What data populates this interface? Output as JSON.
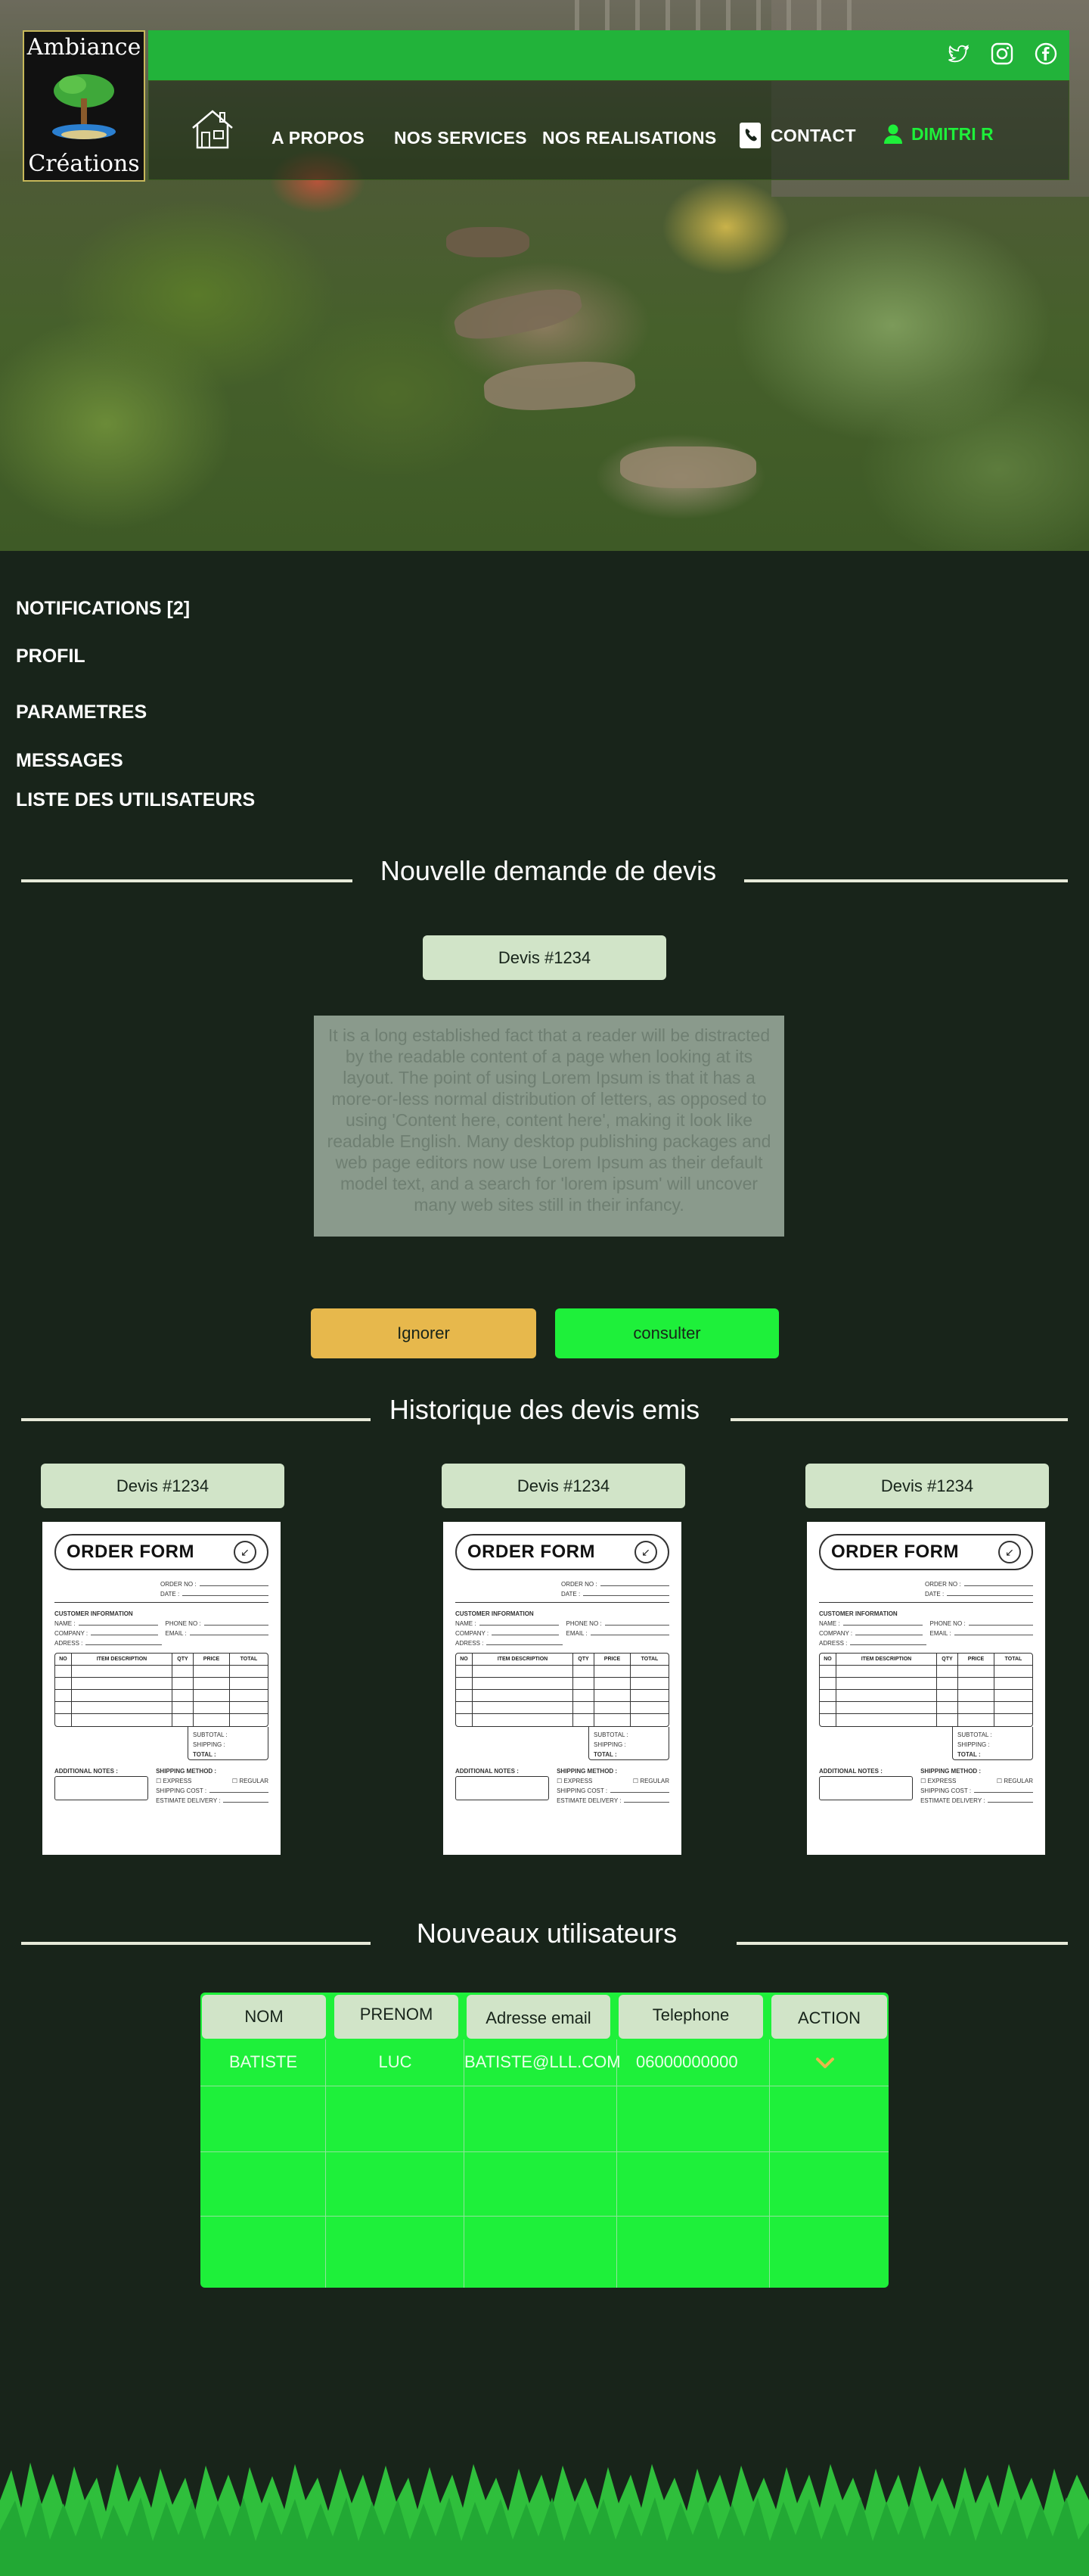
{
  "brand": {
    "line1": "Ambiance",
    "line2": "Créations"
  },
  "nav": {
    "home_icon": "house-icon",
    "items": [
      "A PROPOS",
      "NOS SERVICES",
      "NOS REALISATIONS"
    ],
    "contact_label": "CONTACT",
    "contact_icon": "phone-book-icon",
    "user_label": "DIMITRI R",
    "user_icon": "user-icon",
    "social_icons": [
      "twitter-icon",
      "instagram-icon",
      "facebook-icon"
    ]
  },
  "menu": [
    "NOTIFICATIONS [2]",
    "PROFIL",
    "PARAMETRES",
    "MESSAGES",
    "LISTE DES UTILISATEURS"
  ],
  "request": {
    "title": "Nouvelle demande de devis",
    "devis_label": "Devis #1234",
    "text": "It is a long established fact that a reader will be distracted by the readable content of a page when looking at its layout. The point of using Lorem Ipsum is that it has a more-or-less normal distribution of letters, as opposed to using 'Content here, content here', making it look like readable English. Many desktop publishing packages and web page editors now use Lorem Ipsum as their default model text, and a search for 'lorem ipsum' will uncover many web sites still in their infancy.",
    "ignore_label": "Ignorer",
    "consult_label": "consulter"
  },
  "history": {
    "title": "Historique des devis emis",
    "cards": [
      {
        "label": "Devis #1234"
      },
      {
        "label": "Devis #1234"
      },
      {
        "label": "Devis #1234"
      }
    ]
  },
  "order_form": {
    "title": "ORDER FORM",
    "order_no": "ORDER NO :",
    "date": "DATE :",
    "customer_info": "CUSTOMER INFORMATION",
    "name": "NAME :",
    "phone": "PHONE NO :",
    "company": "COMPANY :",
    "email": "EMAIL :",
    "adress": "ADRESS :",
    "col_no": "NO",
    "col_desc": "ITEM DESCRIPTION",
    "col_qty": "QTY",
    "col_price": "PRICE",
    "col_total": "TOTAL",
    "subtotal": "SUBTOTAL :",
    "shipping": "SHIPPING :",
    "total": "TOTAL :",
    "notes": "ADDITIONAL NOTES :",
    "method": "SHIPPING METHOD :",
    "express": "EXPRESS",
    "regular": "REGULAR",
    "ship_cost": "SHIPPING COST :",
    "delivery": "ESTIMATE DELIVERY :"
  },
  "users": {
    "title": "Nouveaux utilisateurs",
    "headers": [
      "NOM",
      "PRENOM",
      "Adresse email",
      "Telephone",
      "ACTION"
    ],
    "rows": [
      {
        "nom": "BATISTE",
        "prenom": "LUC",
        "email": "BATISTE@LLL.COM",
        "telephone": "06000000000",
        "action_icon": "chevron-down-icon"
      }
    ]
  },
  "colors": {
    "background": "#18241a",
    "accent": "#1ef03a",
    "nav_green": "#22b33a",
    "pill": "#d1e4c8",
    "ignore": "#e7b84c"
  }
}
